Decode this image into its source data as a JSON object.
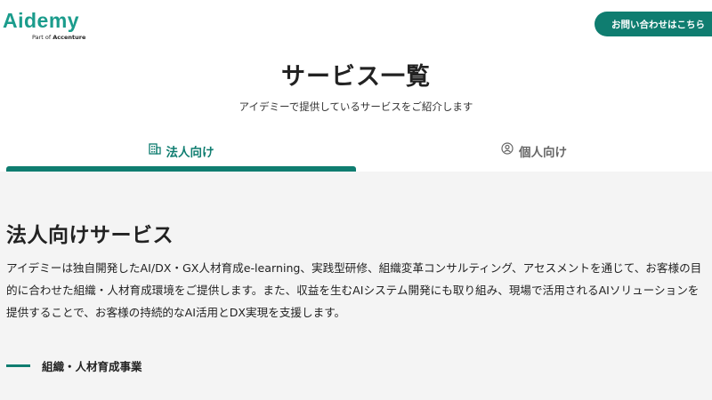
{
  "header": {
    "logo_text": "Aidemy",
    "logo_sub_prefix": "Part of",
    "logo_sub_brand": "Accenture",
    "contact_button": "お問い合わせはこちら"
  },
  "hero": {
    "title": "サービス一覧",
    "subtitle": "アイデミーで提供しているサービスをご紹介します"
  },
  "tabs": [
    {
      "label": "法人向け",
      "icon": "building-icon",
      "active": true
    },
    {
      "label": "個人向け",
      "icon": "person-icon",
      "active": false
    }
  ],
  "main": {
    "section_title": "法人向けサービス",
    "section_body": "アイデミーは独自開発したAI/DX・GX人材育成e-learning、実践型研修、組織変革コンサルティング、アセスメントを通じて、お客様の目的に合わせた組織・人材育成環境をご提供します。また、収益を生むAIシステム開発にも取り組み、現場で活用されるAIソリューションを提供することで、お客様の持続的なAI活用とDX実現を支援します。",
    "subsection_title": "組織・人材育成事業"
  },
  "colors": {
    "brand": "#1b9c8c",
    "accent": "#0f7d70",
    "section_bg": "#f4f4f4"
  }
}
